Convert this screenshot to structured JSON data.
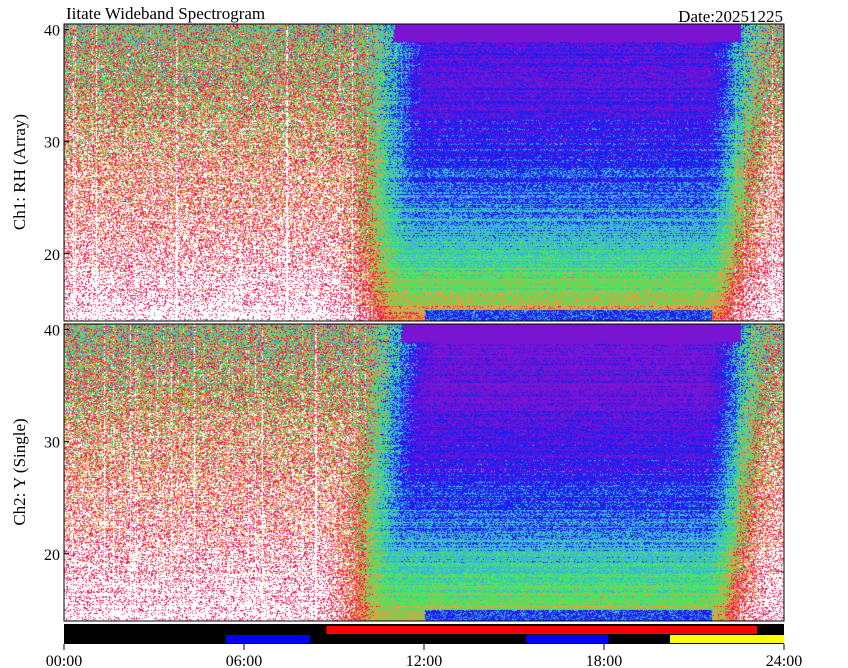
{
  "chart_data": {
    "type": "heatmap",
    "title": "Iitate Wideband Spectrogram",
    "date_label": "Date:20251225",
    "x_axis": {
      "range": [
        0,
        24
      ],
      "ticks": [
        0,
        6,
        12,
        18,
        24
      ],
      "tick_labels": [
        "00:00",
        "06:00",
        "12:00",
        "18:00",
        "24:00"
      ]
    },
    "panels": [
      {
        "name": "Ch1: RH (Array)",
        "ylim": [
          14,
          40.5
        ],
        "yticks": [
          20,
          30,
          40
        ],
        "ytick_labels": [
          "20",
          "30",
          "40"
        ]
      },
      {
        "name": "Ch2: Y (Single)",
        "ylim": [
          14,
          40.5
        ],
        "yticks": [
          20,
          30,
          40
        ],
        "ytick_labels": [
          "20",
          "30",
          "40"
        ]
      }
    ],
    "colors": {
      "white": "#ffffff",
      "red": "#f0145a",
      "orange": "#e6a03c",
      "green": "#46e664",
      "cyan": "#3cb4dc",
      "blue": "#1e1ef0",
      "purple": "#7814d2",
      "black": "#000000",
      "yellow": "#ffff00"
    },
    "status_bar": {
      "background": "#000000",
      "segments": [
        {
          "start": 5.4,
          "end": 8.2,
          "row": "lower",
          "color": "#0000ff"
        },
        {
          "start": 8.75,
          "end": 23.1,
          "row": "upper",
          "color": "#ff0000"
        },
        {
          "start": 15.4,
          "end": 18.15,
          "row": "lower",
          "color": "#0000ff"
        },
        {
          "start": 20.2,
          "end": 24,
          "row": "lower",
          "color": "#ffff00"
        }
      ]
    }
  }
}
